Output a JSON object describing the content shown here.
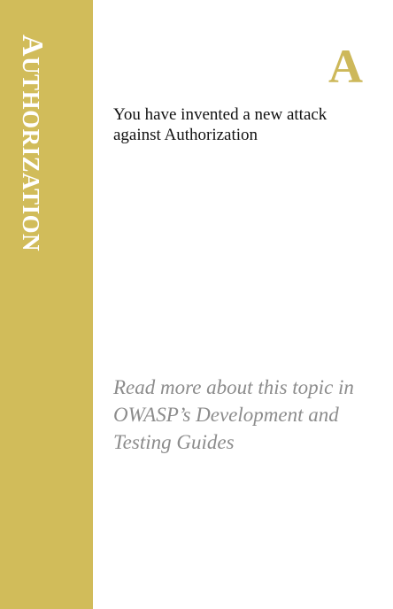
{
  "card": {
    "category": "Authorization",
    "category_initial": "A",
    "category_rest": "UTHORIZATION",
    "letter": "A",
    "text": "You have invented a new attack against Authorization",
    "reference_line1": "Read more about this topic in",
    "reference_line2": "OWASP’s Development and",
    "reference_line3": "Testing Guides"
  },
  "colors": {
    "band": "#d1bc5a",
    "letter": "#cdb85a",
    "text": "#111111",
    "reference": "#8c8c8c",
    "band_text": "#ffffff"
  }
}
